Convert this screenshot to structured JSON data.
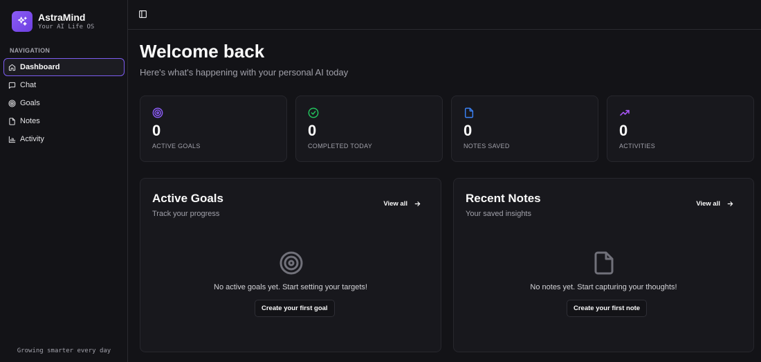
{
  "brand": {
    "name": "AstraMind",
    "tagline": "Your AI Life OS"
  },
  "sidebar": {
    "heading": "NAVIGATION",
    "items": [
      {
        "label": "Dashboard",
        "icon": "home-icon",
        "active": true
      },
      {
        "label": "Chat",
        "icon": "message-square-icon",
        "active": false
      },
      {
        "label": "Goals",
        "icon": "target-icon",
        "active": false
      },
      {
        "label": "Notes",
        "icon": "file-icon",
        "active": false
      },
      {
        "label": "Activity",
        "icon": "bar-chart-icon",
        "active": false
      }
    ],
    "footer": "Growing smarter every day"
  },
  "header": {
    "title": "Welcome back",
    "subtitle": "Here's what's happening with your personal AI today"
  },
  "stats": [
    {
      "value": "0",
      "label": "ACTIVE GOALS",
      "icon": "target-icon",
      "color": "#8b5cf6"
    },
    {
      "value": "0",
      "label": "COMPLETED TODAY",
      "icon": "check-circle-icon",
      "color": "#22c55e"
    },
    {
      "value": "0",
      "label": "NOTES SAVED",
      "icon": "file-icon",
      "color": "#3b82f6"
    },
    {
      "value": "0",
      "label": "ACTIVITIES",
      "icon": "trending-up-icon",
      "color": "#a855f7"
    }
  ],
  "panels": {
    "goals": {
      "title": "Active Goals",
      "subtitle": "Track your progress",
      "view_all": "View all",
      "empty_text": "No active goals yet. Start setting your targets!",
      "button": "Create your first goal"
    },
    "notes": {
      "title": "Recent Notes",
      "subtitle": "Your saved insights",
      "view_all": "View all",
      "empty_text": "No notes yet. Start capturing your thoughts!",
      "button": "Create your first note"
    }
  },
  "colors": {
    "accent": "#8b5cf6",
    "background": "#131317",
    "card": "#18181d"
  }
}
